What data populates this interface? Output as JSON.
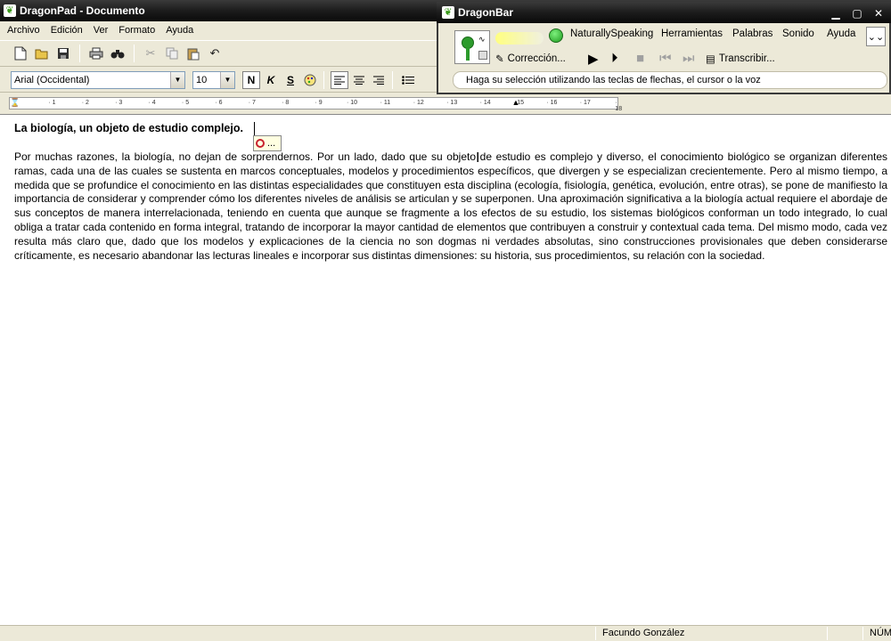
{
  "window": {
    "title": "DragonPad - Documento",
    "app_icon": "dragon-icon"
  },
  "menu": [
    "Archivo",
    "Edición",
    "Ver",
    "Formato",
    "Ayuda"
  ],
  "toolbar": {
    "icons": [
      "new-document-icon",
      "open-folder-icon",
      "save-icon",
      "print-icon",
      "find-binoculars-icon",
      "cut-icon",
      "copy-icon",
      "paste-icon",
      "undo-icon"
    ]
  },
  "format": {
    "font": "Arial (Occidental)",
    "size": "10",
    "bold": "N",
    "italic": "K",
    "underline": "S"
  },
  "ruler": {
    "ticks": [
      "1",
      "2",
      "3",
      "4",
      "5",
      "6",
      "7",
      "8",
      "9",
      "10",
      "11",
      "12",
      "13",
      "14",
      "15",
      "16",
      "17",
      "18"
    ]
  },
  "document": {
    "title": "La biología, un objeto de estudio complejo.",
    "body": "Por muchas razones, la biología, no dejan de sorprendernos. Por un lado, dado que su objeto de estudio es complejo y diverso, el conocimiento biológico se organizan diferentes ramas, cada una de las cuales se sustenta en marcos conceptuales, modelos y procedimientos específicos, que divergen y se especializan crecientemente. Pero al mismo tiempo, a medida que se profundice el conocimiento en las distintas especialidades que constituyen esta disciplina (ecología, fisiología, genética, evolución, entre otras), se pone de manifiesto la importancia de considerar y comprender cómo los diferentes niveles de análisis se articulan y se superponen. Una aproximación significativa a la biología actual requiere el abordaje de sus conceptos de manera interrelacionada, teniendo en cuenta que aunque se fragmente a los efectos de su estudio, los sistemas biológicos conforman un todo integrado, lo cual obliga a tratar cada contenido en forma integral, tratando de incorporar la mayor cantidad de elementos que contribuyen a construir y contextual cada tema. Del mismo modo, cada vez resulta más claro que, dado que los modelos y explicaciones de la ciencia no son dogmas ni verdades absolutas, sino construcciones provisionales que deben considerarse críticamente, es necesario abandonar las lecturas lineales e incorporar sus distintas dimensiones: su historia, sus procedimientos, su relación con la sociedad.",
    "correction_popup": "..."
  },
  "status": {
    "user": "Facundo González",
    "mode": "NÚM"
  },
  "dragonbar": {
    "title": "DragonBar",
    "menus": [
      "NaturallySpeaking",
      "Herramientas",
      "Palabras",
      "Sonido",
      "Ayuda"
    ],
    "correction": "Corrección...",
    "transcribe": "Transcribir...",
    "hint": "Haga su selección utilizando las teclas de flechas, el cursor o la voz"
  }
}
